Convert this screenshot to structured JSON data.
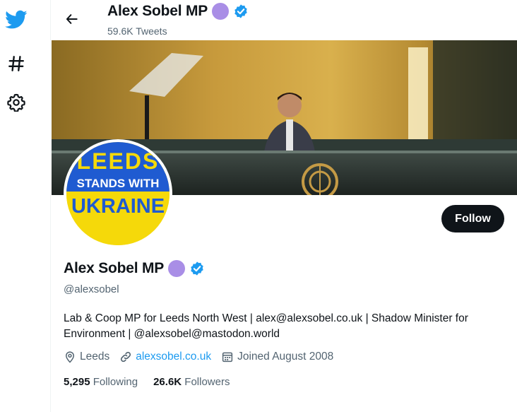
{
  "header": {
    "name": "Alex Sobel MP",
    "tweets_count": "59.6K Tweets"
  },
  "avatar": {
    "line1": "LEEDS",
    "line2": "STANDS WITH",
    "line3": "UKRAINE",
    "colors": {
      "top": "#1f5bd1",
      "bottom": "#f5d90a"
    }
  },
  "profile": {
    "name": "Alex Sobel MP",
    "handle": "@alexsobel",
    "bio_line1": "Lab & Coop MP for Leeds North West | alex@alexsobel.co.uk | Shadow Minister for",
    "bio_line2": "Environment | @alexsobel@mastodon.world",
    "location": "Leeds",
    "website": "alexsobel.co.uk",
    "joined": "Joined August 2008",
    "following_count": "5,295",
    "following_label": "Following",
    "followers_count": "26.6K",
    "followers_label": "Followers"
  },
  "follow_button": "Follow",
  "icons": {
    "sidebar": [
      "twitter-bird-icon",
      "hashtag-icon",
      "gear-icon"
    ],
    "back": "back-arrow-icon",
    "location": "location-pin-icon",
    "link": "link-icon",
    "calendar": "calendar-icon"
  },
  "colors": {
    "accent": "#1d9bf0",
    "verified": "#1d9bf0",
    "label_dot": "#a98ee6",
    "secondary_text": "#536471",
    "follow_button_bg": "#0f1419"
  }
}
